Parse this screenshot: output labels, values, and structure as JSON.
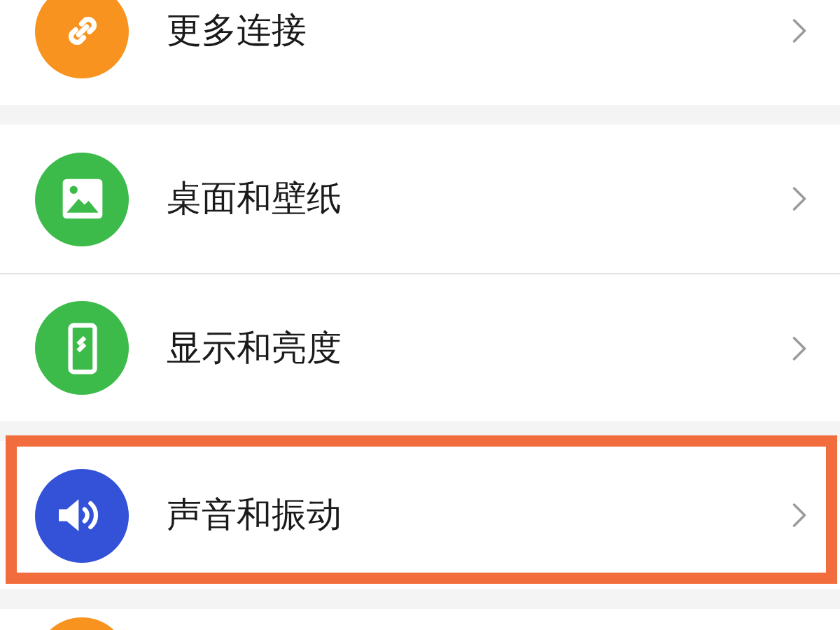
{
  "sections": [
    {
      "items": [
        {
          "kind": "link",
          "color": "#f7931e",
          "label": "更多连接",
          "highlighted": false
        }
      ]
    },
    {
      "items": [
        {
          "kind": "image",
          "color": "#3dbb4a",
          "label": "桌面和壁纸",
          "highlighted": false
        },
        {
          "kind": "phone",
          "color": "#3dbb4a",
          "label": "显示和亮度",
          "highlighted": false
        }
      ]
    },
    {
      "items": [
        {
          "kind": "speaker",
          "color": "#3452d8",
          "label": "声音和振动",
          "highlighted": true
        }
      ]
    },
    {
      "items": [
        {
          "kind": "blank",
          "color": "#f7931e",
          "highlighted": false
        }
      ]
    }
  ]
}
